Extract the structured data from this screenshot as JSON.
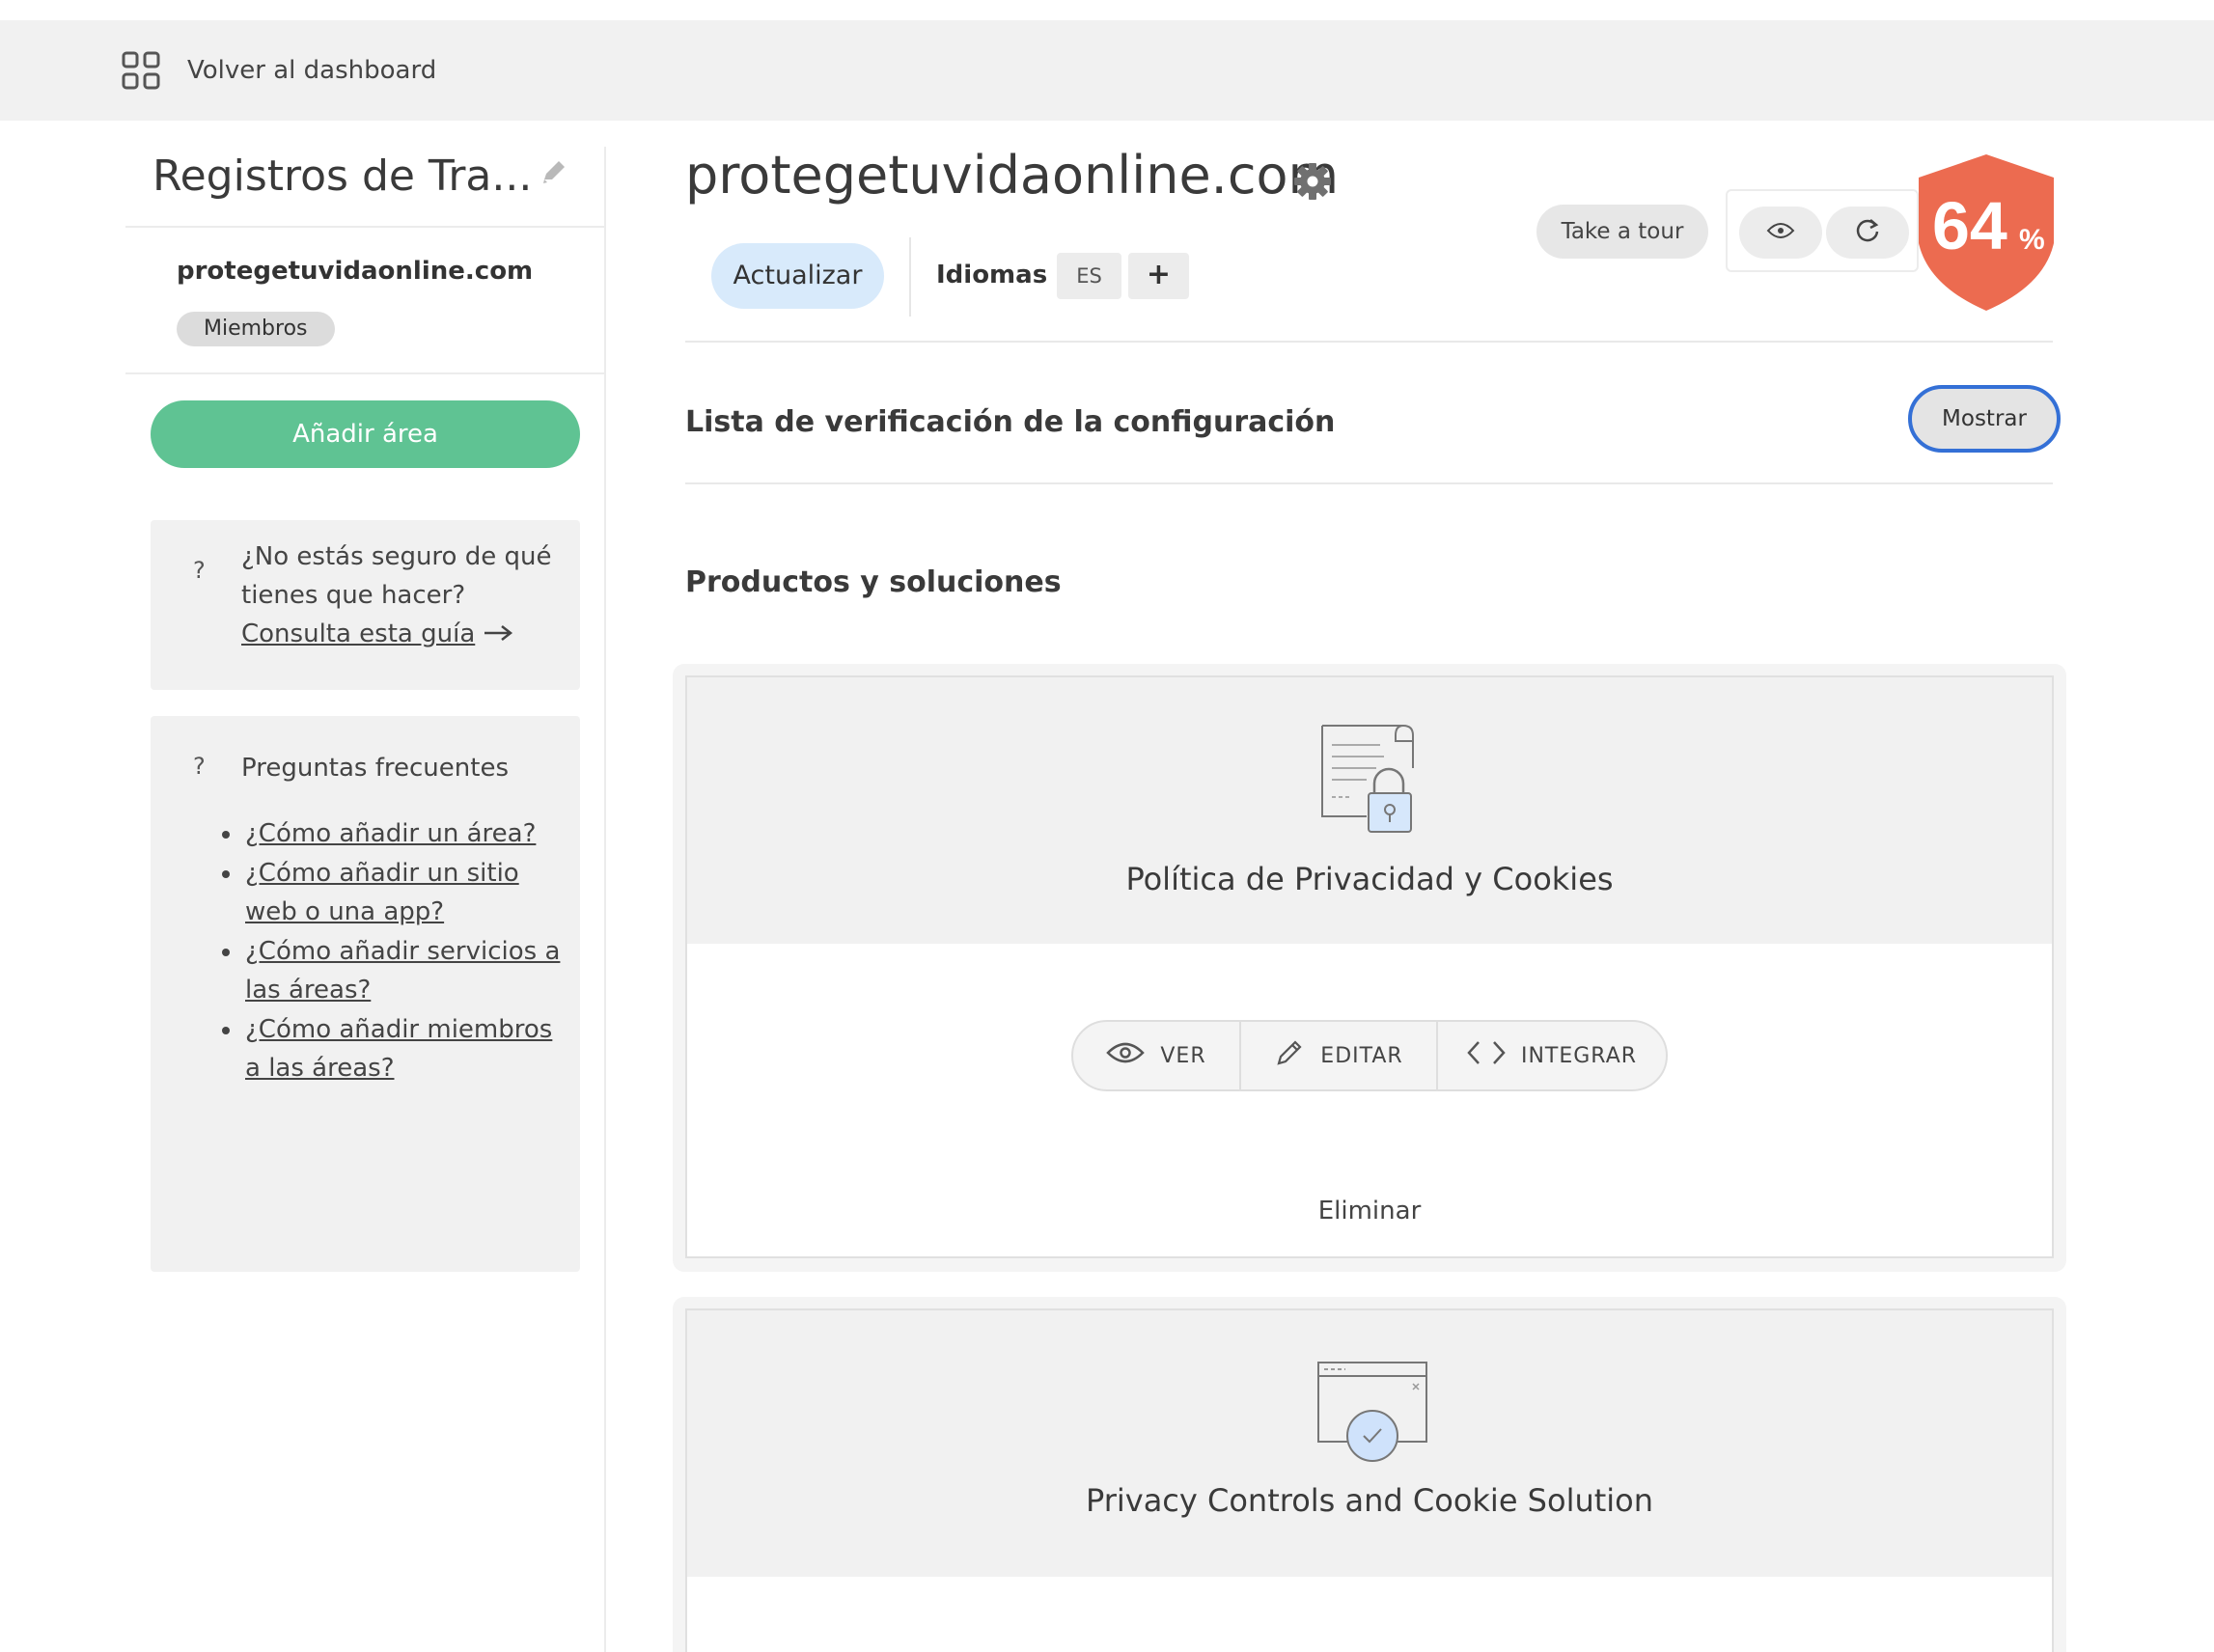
{
  "topbar": {
    "back_label": "Volver al dashboard",
    "back_icon": "grid-icon"
  },
  "sidebar": {
    "title": "Registros de Tra...",
    "domain": "protegetuvidaonline.com",
    "badge": "Miembros",
    "add_area_label": "Añadir área",
    "guide": {
      "question_mark": "?",
      "text": "¿No estás seguro de qué tienes que hacer?",
      "link": "Consulta esta guía"
    },
    "faq": {
      "question_mark": "?",
      "title": "Preguntas frecuentes",
      "items": [
        "¿Cómo añadir un área?",
        "¿Cómo añadir un sitio web o una app?",
        "¿Cómo añadir servicios a las áreas?",
        "¿Cómo añadir miembros a las áreas?"
      ]
    }
  },
  "header": {
    "title": "protegetuvidaonline.com",
    "update_label": "Actualizar",
    "languages_label": "Idiomas",
    "language_code": "ES",
    "add_language_label": "+",
    "tour_label": "Take a tour",
    "score_value": "64",
    "score_unit": "%",
    "score_color": "#ec6b50"
  },
  "checklist": {
    "title": "Lista de verificación de la configuración",
    "show_label": "Mostrar"
  },
  "products": {
    "title": "Productos y soluciones",
    "cards": [
      {
        "title": "Política de Privacidad y Cookies",
        "icon": "privacy-policy-document-lock-icon",
        "actions": [
          "VER",
          "EDITAR",
          "INTEGRAR"
        ],
        "delete_label": "Eliminar"
      },
      {
        "title": "Privacy Controls and Cookie Solution",
        "icon": "cookie-browser-window-icon"
      }
    ]
  },
  "colors": {
    "accent_green": "#5fc393",
    "update_blue": "#d8eafb",
    "focus_blue": "#3470d6"
  }
}
